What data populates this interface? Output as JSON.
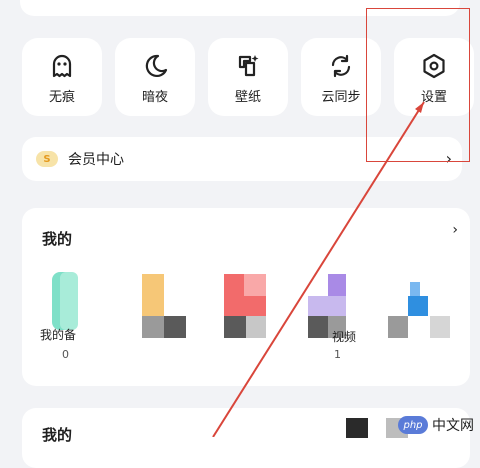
{
  "toolbar": {
    "items": [
      {
        "label": "无痕",
        "icon": "ghost-icon"
      },
      {
        "label": "暗夜",
        "icon": "moon-icon"
      },
      {
        "label": "壁纸",
        "icon": "wallpaper-icon"
      },
      {
        "label": "云同步",
        "icon": "sync-icon"
      },
      {
        "label": "设置",
        "icon": "settings-hexagon-icon"
      }
    ]
  },
  "member": {
    "coin": "S",
    "label": "会员中心"
  },
  "section1": {
    "title": "我的",
    "items": [
      {
        "label": "我的备",
        "count": "0"
      },
      {
        "label": "",
        "count": ""
      },
      {
        "label": "",
        "count": ""
      },
      {
        "label": "视频",
        "count": "1"
      },
      {
        "label": "",
        "count": ""
      }
    ]
  },
  "section2": {
    "title": "我的"
  },
  "watermark": {
    "logo": "php",
    "text": "中文网"
  },
  "colors": {
    "annotation": "#d9463b",
    "background": "#f2f3f6",
    "card": "#ffffff"
  }
}
